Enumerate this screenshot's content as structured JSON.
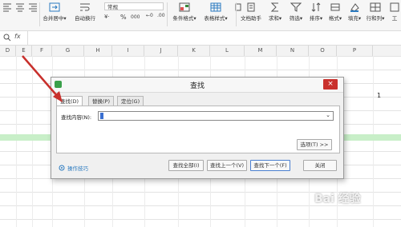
{
  "ribbon": {
    "number_format": "常规",
    "items": [
      {
        "label": "合并居中",
        "icon": "merge-center-icon"
      },
      {
        "label": "自动换行",
        "icon": "wrap-text-icon"
      },
      {
        "label": "条件格式",
        "icon": "conditional-format-icon"
      },
      {
        "label": "表格样式",
        "icon": "table-style-icon"
      },
      {
        "label": "文档助手",
        "icon": "doc-assistant-icon"
      },
      {
        "label": "求和",
        "icon": "sum-icon"
      },
      {
        "label": "筛选",
        "icon": "filter-icon"
      },
      {
        "label": "排序",
        "icon": "sort-icon"
      },
      {
        "label": "格式",
        "icon": "format-icon"
      },
      {
        "label": "填充",
        "icon": "fill-icon"
      },
      {
        "label": "行和列",
        "icon": "row-col-icon"
      },
      {
        "label": "工",
        "icon": "worksheet-icon"
      }
    ],
    "percent_symbol": "%",
    "thousands_symbol": "000"
  },
  "formula_bar": {
    "fx_label": "fx"
  },
  "columns": [
    "D",
    "E",
    "F",
    "G",
    "H",
    "I",
    "J",
    "K",
    "L",
    "M",
    "N",
    "O",
    "P"
  ],
  "cell_value": "1",
  "dialog": {
    "title": "查找",
    "close_label": "×",
    "tabs": [
      "查找(D)",
      "替换(P)",
      "定位(G)"
    ],
    "find_label": "查找内容(N):",
    "find_value": "",
    "options_button": "选项(T) >>",
    "tips_link": "操作技巧",
    "buttons": {
      "find_all": "查找全部(I)",
      "find_prev": "查找上一个(V)",
      "find_next": "查找下一个(F)",
      "close": "关闭"
    }
  },
  "watermark": "Bai 经验",
  "colors": {
    "green_row": "#c8efc8",
    "arrow": "#c8302c",
    "close_btn": "#c9302c"
  }
}
